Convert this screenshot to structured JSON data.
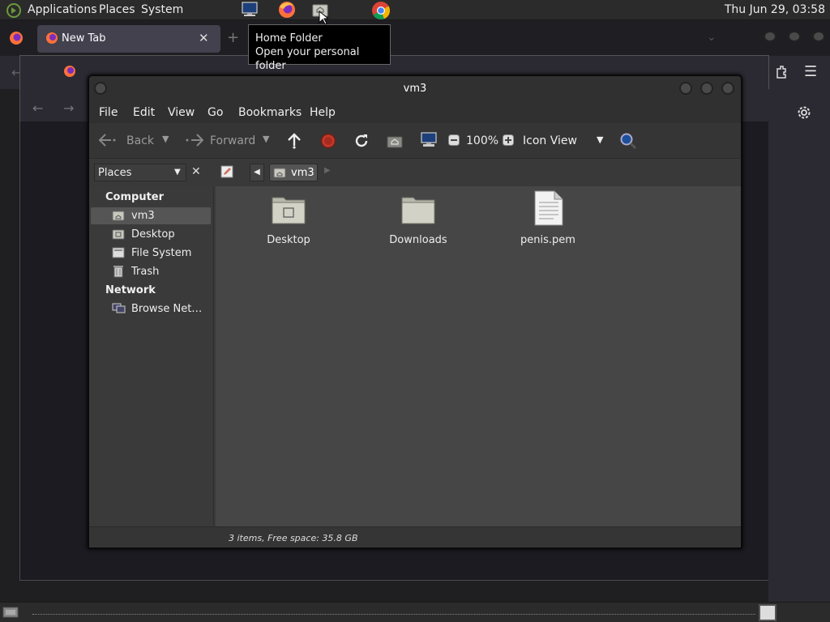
{
  "top_panel": {
    "menus": [
      "Applications",
      "Places",
      "System"
    ],
    "clock": "Thu Jun 29, 03:58"
  },
  "browser": {
    "tab_label": "New Tab",
    "new_tab_symbol": "+"
  },
  "tooltip": {
    "title": "Home Folder",
    "subtitle": "Open your personal folder"
  },
  "file_manager": {
    "window_title": "vm3",
    "menu": [
      "File",
      "Edit",
      "View",
      "Go",
      "Bookmarks",
      "Help"
    ],
    "toolbar": {
      "back_label": "Back",
      "forward_label": "Forward",
      "zoom_level": "100%",
      "view_mode": "Icon View"
    },
    "sidebar_selector": "Places",
    "breadcrumb": "vm3",
    "sidebar": {
      "computer_heading": "Computer",
      "computer_items": [
        "vm3",
        "Desktop",
        "File System",
        "Trash"
      ],
      "network_heading": "Network",
      "network_items": [
        "Browse Net…"
      ]
    },
    "files": [
      {
        "name": "Desktop",
        "kind": "folder"
      },
      {
        "name": "Downloads",
        "kind": "folder"
      },
      {
        "name": "penis.pem",
        "kind": "file"
      }
    ],
    "status": "3 items, Free space: 35.8 GB"
  },
  "colors": {
    "panel": "#2b2b2b",
    "selection": "#555555",
    "content_bg": "#464646",
    "stop_red": "#c0392b"
  }
}
